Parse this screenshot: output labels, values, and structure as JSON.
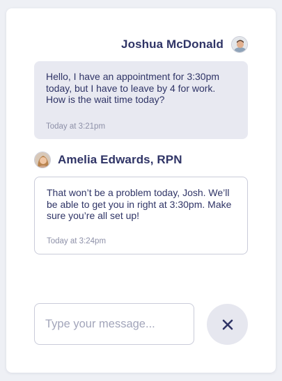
{
  "messages": [
    {
      "sender": "Joshua McDonald",
      "text": "Hello, I have an appointment for 3:30pm today, but I have to leave by 4 for work. How is the wait time today?",
      "time": "Today at 3:21pm"
    },
    {
      "sender": "Amelia Edwards, RPN",
      "text": "That won’t be a problem today, Josh. We’ll be able to get you in right at 3:30pm. Make sure you’re all set up!",
      "time": "Today at 3:24pm"
    }
  ],
  "composer": {
    "placeholder": "Type your message...",
    "close_icon": "close-icon"
  },
  "colors": {
    "name_text": "#2f3466",
    "incoming_bubble": "#e8e9f1",
    "timestamp": "#8d90a8",
    "close_button_bg": "#e6e7ef"
  }
}
